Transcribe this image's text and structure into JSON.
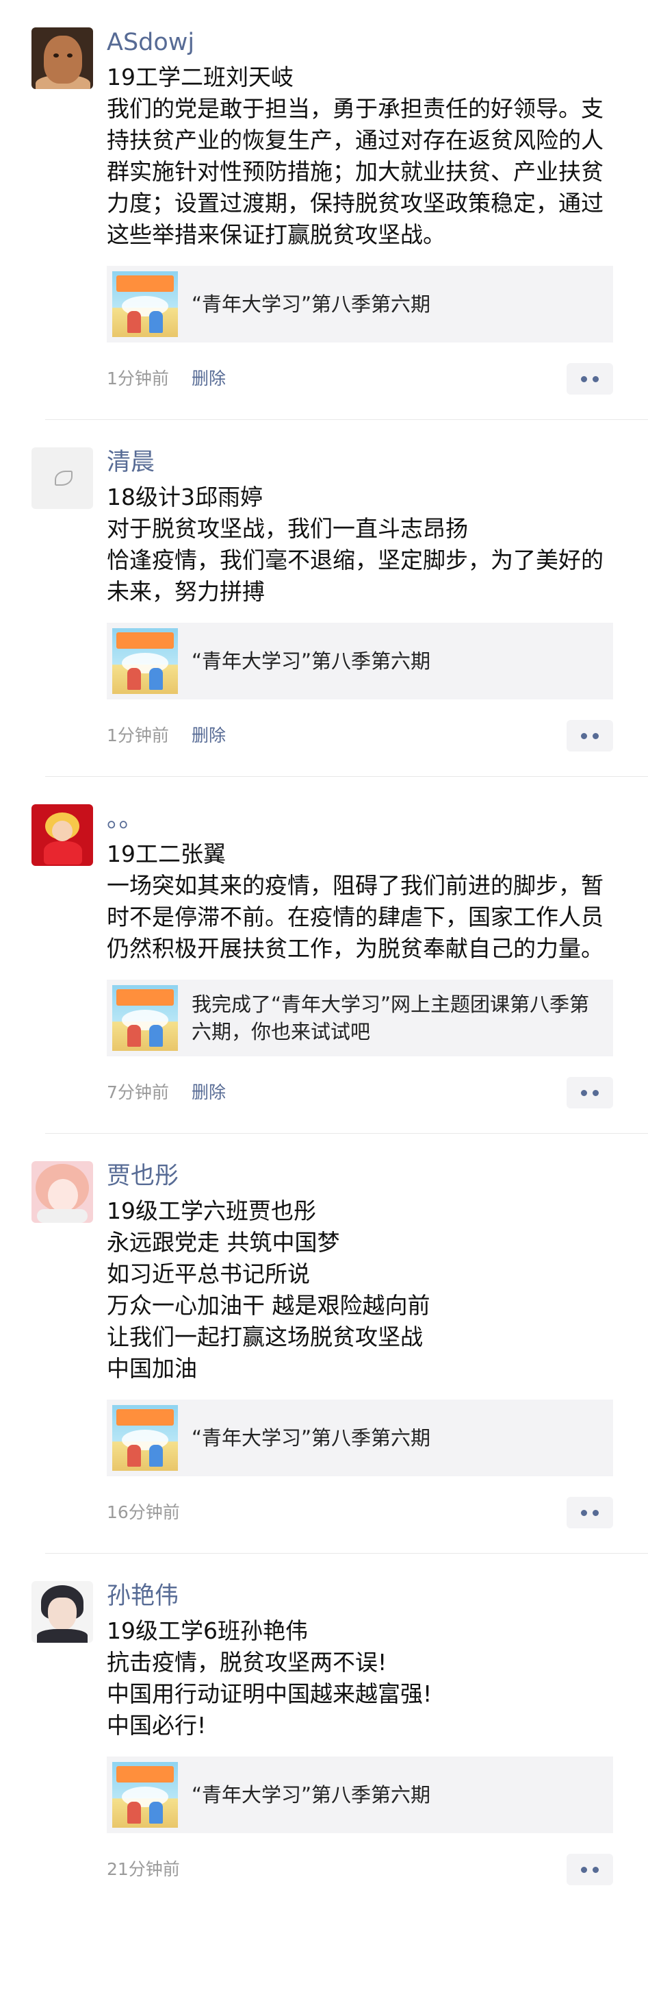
{
  "posts": [
    {
      "name": "ASdowj",
      "text": "19工学二班刘天岐\n我们的党是敢于担当，勇于承担责任的好领导。支持扶贫产业的恢复生产，通过对存在返贫风险的人群实施针对性预防措施；加大就业扶贫、产业扶贫力度；设置过渡期，保持脱贫攻坚政策稳定，通过这些举措来保证打赢脱贫攻坚战。",
      "link_title": "“青年大学习”第八季第六期",
      "time": "1分钟前",
      "delete_label": "删除"
    },
    {
      "name": "清晨",
      "text": "18级计3邱雨婷\n对于脱贫攻坚战，我们一直斗志昂扬\n恰逢疫情，我们毫不退缩，坚定脚步，为了美好的未来，努力拼搏",
      "link_title": "“青年大学习”第八季第六期",
      "time": "1分钟前",
      "delete_label": "删除"
    },
    {
      "name": "。。",
      "text": "19工二张翼\n一场突如其来的疫情，阻碍了我们前进的脚步，暂时不是停滞不前。在疫情的肆虐下，国家工作人员仍然积极开展扶贫工作，为脱贫奉献自己的力量。",
      "link_title": "我完成了“青年大学习”网上主题团课第八季第六期，你也来试试吧",
      "time": "7分钟前",
      "delete_label": "删除"
    },
    {
      "name": "贾也彤",
      "text": "19级工学六班贾也彤\n永远跟党走 共筑中国梦\n如习近平总书记所说\n万众一心加油干 越是艰险越向前\n让我们一起打赢这场脱贫攻坚战\n中国加油",
      "link_title": "“青年大学习”第八季第六期",
      "time": "16分钟前",
      "delete_label": ""
    },
    {
      "name": "孙艳伟",
      "text": "19级工学6班孙艳伟\n抗击疫情，脱贫攻坚两不误!\n中国用行动证明中国越来越富强!\n中国必行!",
      "link_title": "“青年大学习”第八季第六期",
      "time": "21分钟前",
      "delete_label": ""
    }
  ]
}
